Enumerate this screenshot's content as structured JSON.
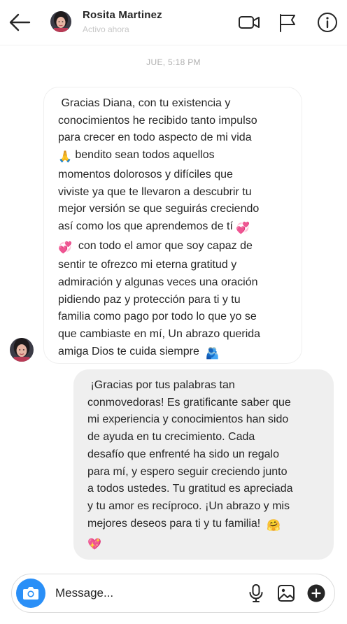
{
  "header": {
    "name": "Rosita Martinez",
    "status": "Activo ahora"
  },
  "thread": {
    "timestamp": "JUE, 5:18 PM",
    "incoming": {
      "text_a": " Gracias Diana, con tu existencia y\nconocimientos he recibido tanto impulso\npara crecer en todo aspecto de mi vida\n",
      "emoji_1": "🙏",
      "text_b": " bendito sean todos aquellos\nmomentos dolorosos y difíciles que\nviviste ya que te llevaron a descubrir tu\nmejor versión se que seguirás creciendo\nasí como los que aprendemos de tí ",
      "emoji_2": "💞",
      "emoji_3": "💞",
      "text_c": "  con todo el amor que soy capaz de\nsentir te ofrezco mi eterna gratitud y\nadmiración y algunas veces una oración\npidiendo paz y protección para ti y tu\nfamilia como pago por todo lo que yo se\nque cambiaste en mí, Un abrazo querida\namiga Dios te cuida siempre  ",
      "emoji_4": "🫂"
    },
    "outgoing": {
      "text_a": " ¡Gracias por tus palabras tan\nconmovedoras! Es gratificante saber que\nmi experiencia y conocimientos han sido\nde ayuda en tu crecimiento. Cada\ndesafío que enfrenté ha sido un regalo\npara mí, y espero seguir creciendo junto\na todos ustedes. Tu gratitud es apreciada\ny tu amor es recíproco. ¡Un abrazo y mis\nmejores deseos para ti y tu familia!  ",
      "emoji_1": "🤗",
      "emoji_2": "💖"
    }
  },
  "composer": {
    "placeholder": "Message..."
  },
  "icons": {
    "back": "arrow-left-icon",
    "video": "video-camera-icon",
    "report": "flag-icon",
    "info": "info-icon",
    "camera": "camera-icon",
    "mic": "microphone-icon",
    "gallery": "image-gallery-icon",
    "add": "plus-circle-icon"
  },
  "colors": {
    "accent": "#2a8ff7",
    "outgoing_bubble": "#efefef",
    "muted_text": "#c7c7c7"
  }
}
